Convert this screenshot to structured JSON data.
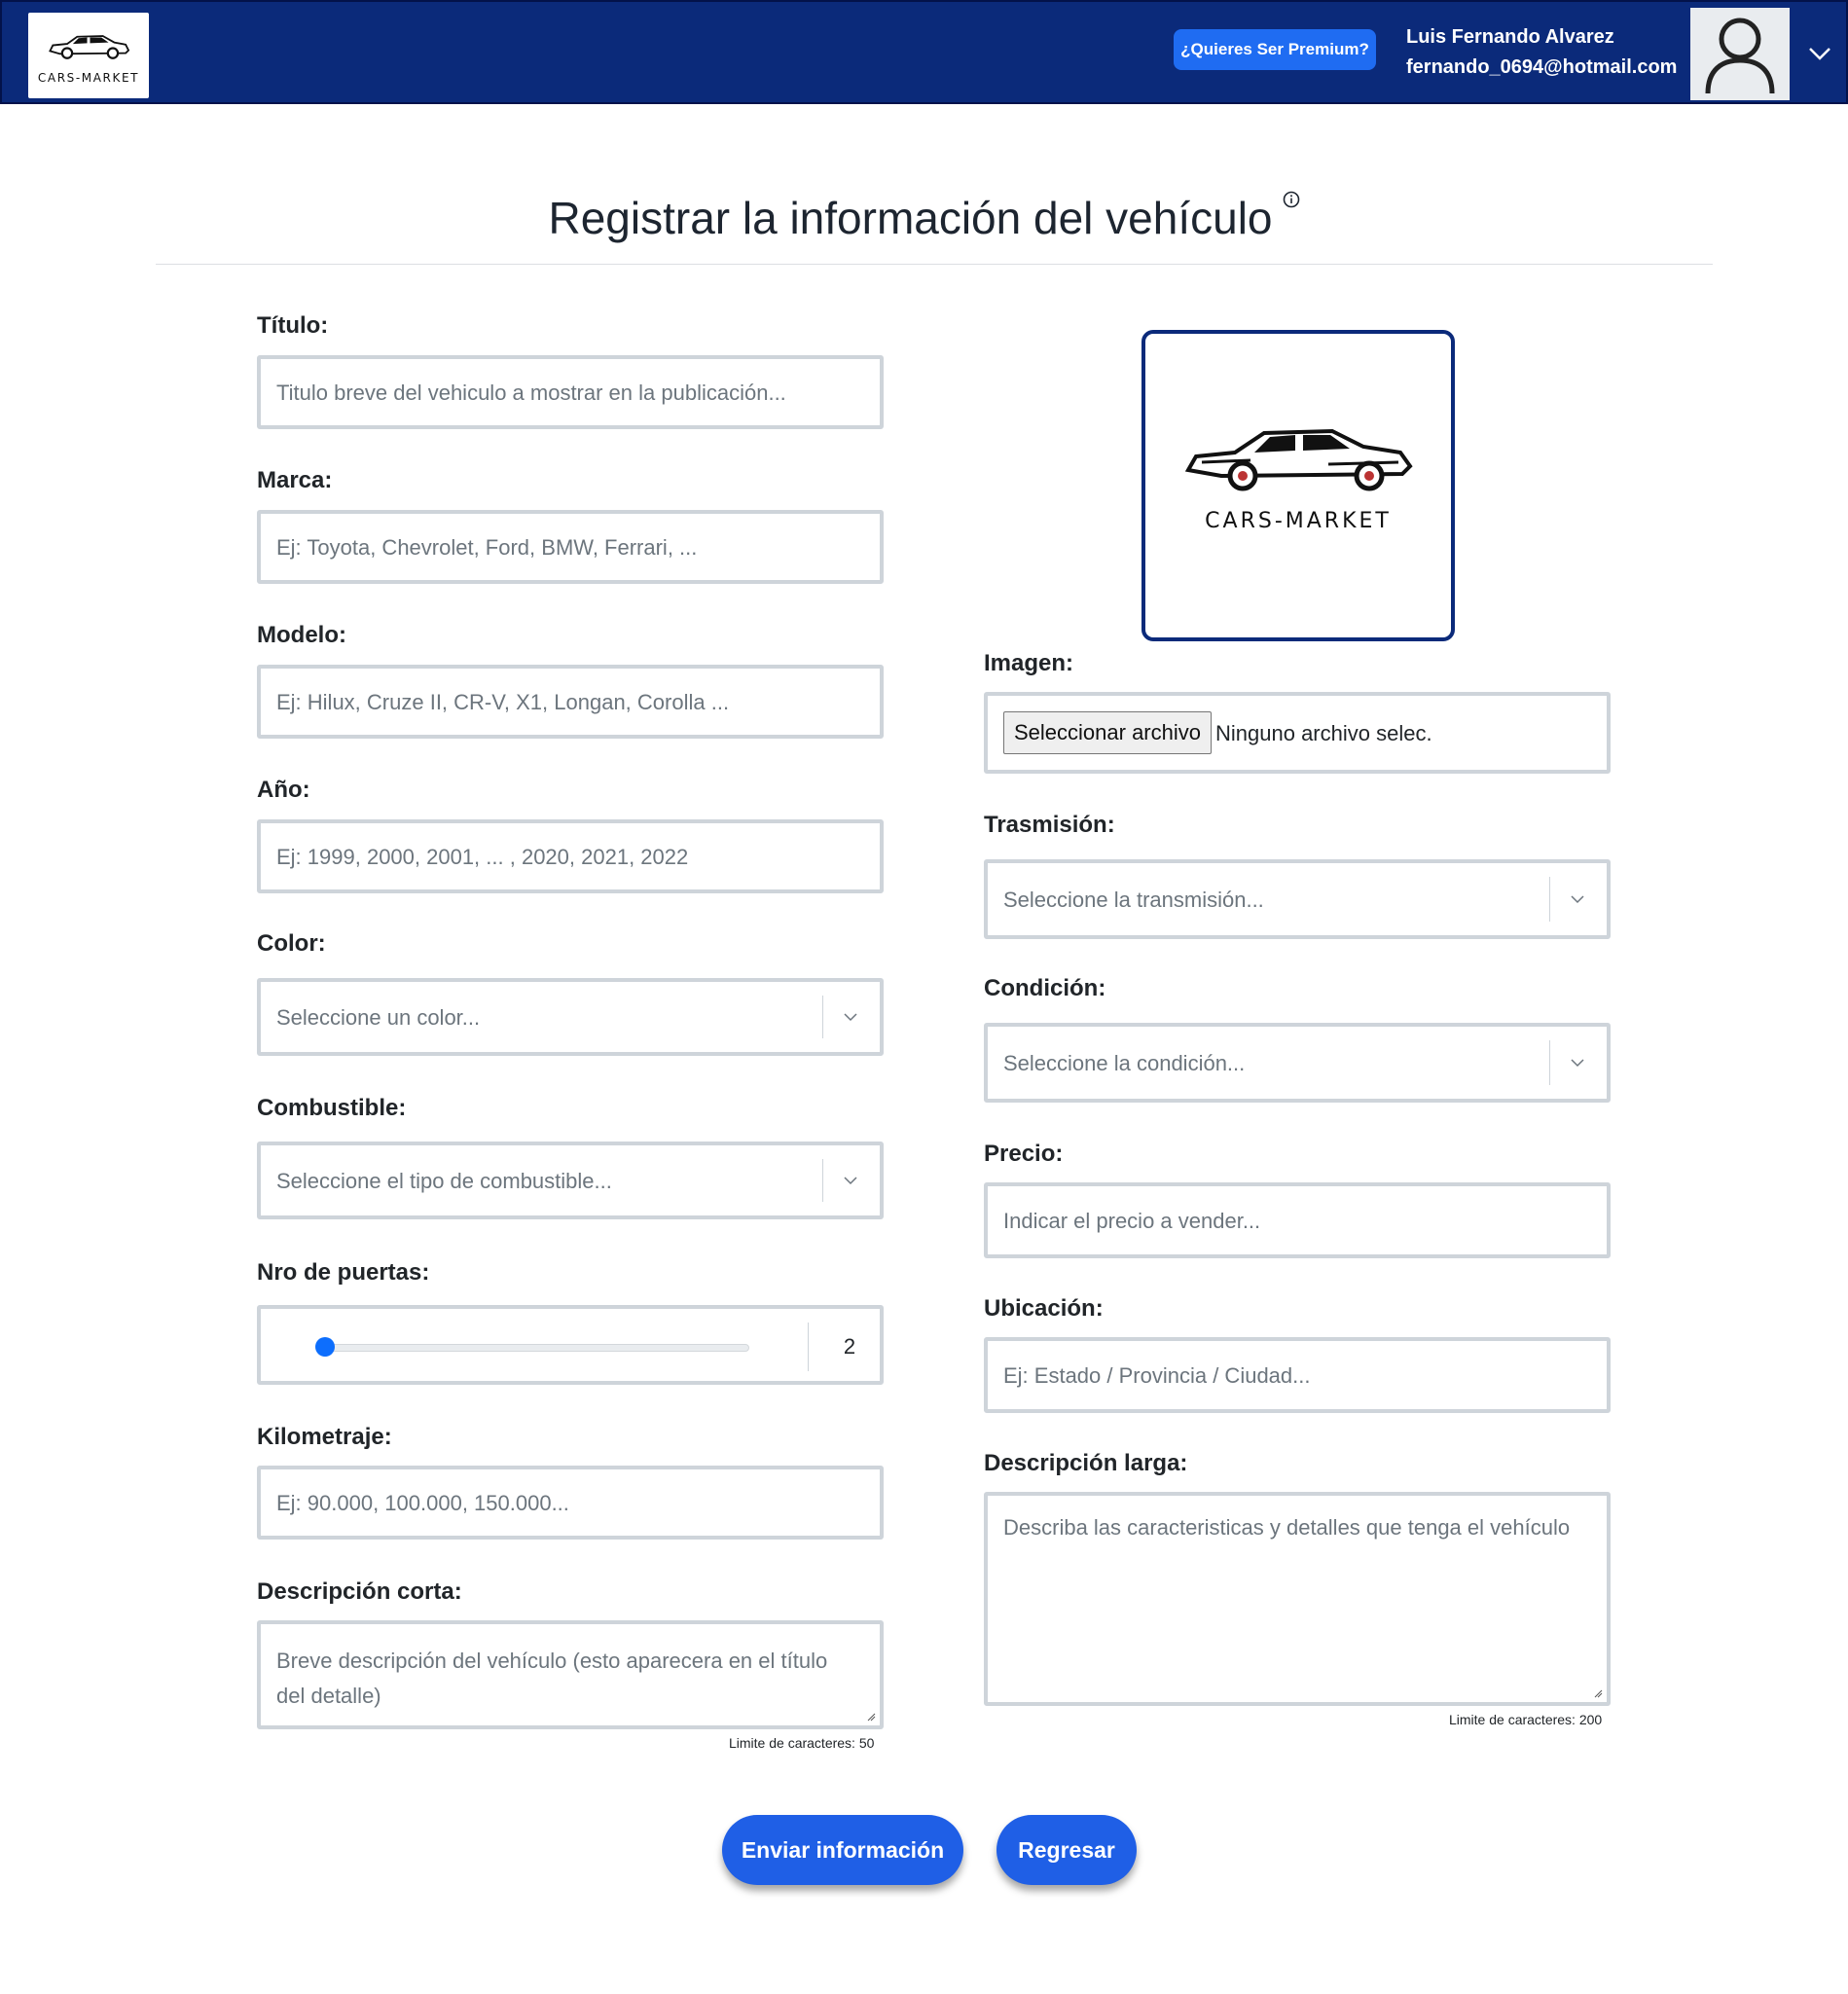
{
  "header": {
    "brand_logo_text": "CARS-MARKET",
    "premium_button": "¿Quieres Ser Premium?",
    "user_name": "Luis Fernando Alvarez",
    "user_email": "fernando_0694@hotmail.com",
    "menu_icon": "chevron-down-icon",
    "avatar_icon": "user-avatar-icon",
    "brand_color": "#0b2a7a"
  },
  "page": {
    "title": "Registrar la información del vehículo",
    "title_icon": "info-icon"
  },
  "form": {
    "titulo": {
      "label": "Título:",
      "placeholder": "Titulo breve del vehiculo a mostrar en la publicación..."
    },
    "marca": {
      "label": "Marca:",
      "placeholder": "Ej: Toyota, Chevrolet, Ford, BMW, Ferrari, ..."
    },
    "modelo": {
      "label": "Modelo:",
      "placeholder": "Ej: Hilux, Cruze II, CR-V, X1, Longan, Corolla ..."
    },
    "anio": {
      "label": "Año:",
      "placeholder": "Ej: 1999, 2000, 2001, ... , 2020, 2021, 2022"
    },
    "color": {
      "label": "Color:",
      "placeholder": "Seleccione un color..."
    },
    "combustible": {
      "label": "Combustible:",
      "placeholder": "Seleccione el tipo de combustible..."
    },
    "puertas": {
      "label": "Nro de puertas:",
      "value": "2"
    },
    "kilometraje": {
      "label": "Kilometraje:",
      "placeholder": "Ej: 90.000, 100.000, 150.000..."
    },
    "descripcion_corta": {
      "label": "Descripción corta:",
      "placeholder": "Breve descripción del vehículo (esto aparecera en el título del detalle)",
      "hint": "Limite de caracteres: 50"
    },
    "imagen": {
      "label": "Imagen:",
      "button": "Seleccionar archivo",
      "status": "Ninguno archivo selec.",
      "preview_logo_text": "CARS-MARKET"
    },
    "trasmision": {
      "label": "Trasmisión:",
      "placeholder": "Seleccione la transmisión..."
    },
    "condicion": {
      "label": "Condición:",
      "placeholder": "Seleccione la condición..."
    },
    "precio": {
      "label": "Precio:",
      "placeholder": "Indicar el precio a vender..."
    },
    "ubicacion": {
      "label": "Ubicación:",
      "placeholder": "Ej: Estado / Provincia / Ciudad..."
    },
    "descripcion_larga": {
      "label": "Descripción larga:",
      "placeholder": "Describa las caracteristicas y detalles que tenga el vehículo",
      "hint": "Limite de caracteres: 200"
    }
  },
  "actions": {
    "submit": "Enviar información",
    "back": "Regresar",
    "accent_color": "#1f5fe6"
  }
}
